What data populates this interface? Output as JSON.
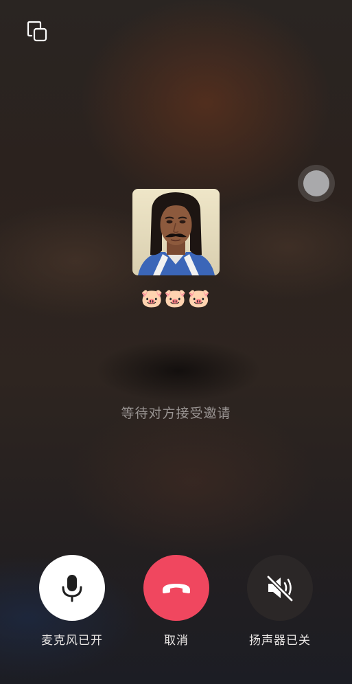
{
  "call": {
    "contact_name": "🐷🐷🐷",
    "status_text": "等待对方接受邀请"
  },
  "controls": {
    "mic_label": "麦克风已开",
    "cancel_label": "取消",
    "speaker_label": "扬声器已关"
  },
  "icons": {
    "minimize": "minimize-window-icon",
    "mic": "microphone-icon",
    "hangup": "hang-up-phone-icon",
    "speaker_off": "speaker-muted-icon"
  },
  "colors": {
    "cancel_button": "#f0475f",
    "mic_button": "#ffffff",
    "speaker_button": "#2b2727",
    "status_text": "#9a9593"
  }
}
